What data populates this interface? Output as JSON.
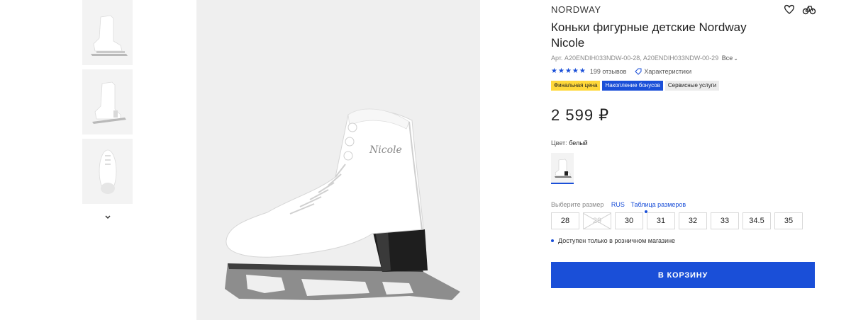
{
  "product": {
    "brand": "NORDWAY",
    "title": "Коньки фигурные детские Nordway Nicole",
    "sku_text": "Арт. A20ENDIH033NDW-00-28, A20ENDIH033NDW-00-29",
    "sku_all_label": "Все",
    "rating_stars": 5,
    "reviews_label": "199 отзывов",
    "specs_label": "Характеристики",
    "badges": {
      "final_price": "Финальная цена",
      "bonus": "Накопление бонусов",
      "services": "Сервисные услуги"
    },
    "price": "2 599 ₽",
    "color_label": "Цвет:",
    "color_value": "белый",
    "size": {
      "choose_label": "Выберите размер",
      "system": "RUS",
      "table_link": "Таблица размеров",
      "options": [
        "28",
        "29",
        "30",
        "31",
        "32",
        "33",
        "34.5",
        "35"
      ],
      "disabled": [
        "29"
      ]
    },
    "availability": "Доступен только в розничном магазине",
    "cart_button": "В КОРЗИНУ"
  },
  "colors": {
    "accent": "#1a4fd8",
    "badge_yellow": "#ffd83a",
    "image_bg": "#efefef"
  },
  "icons": {
    "favorite": "heart-icon",
    "compare": "compare-icon",
    "specs": "tag-icon",
    "gallery_more": "chevron-down-icon"
  }
}
